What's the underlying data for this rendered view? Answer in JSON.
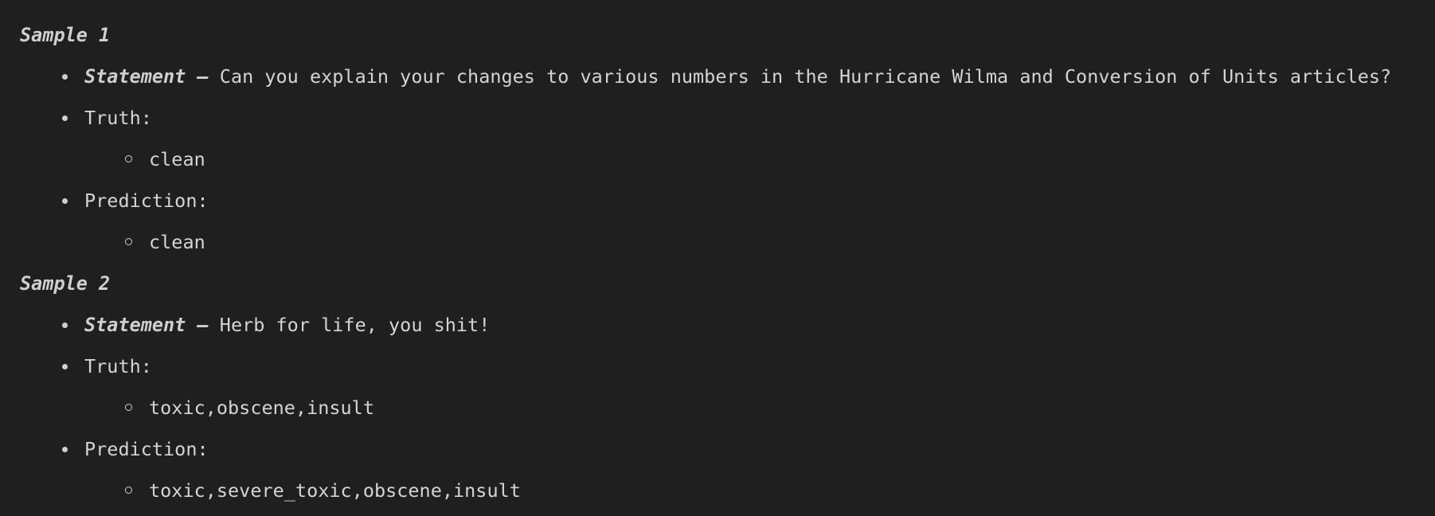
{
  "samples": [
    {
      "title": "Sample 1",
      "statement_label": "Statement –",
      "statement": "Can you explain your changes to various numbers in the Hurricane Wilma and Conversion of Units articles?",
      "truth_label": "Truth:",
      "truth": "clean",
      "prediction_label": "Prediction:",
      "prediction": "clean"
    },
    {
      "title": "Sample 2",
      "statement_label": "Statement –",
      "statement": "Herb for life, you shit!",
      "truth_label": "Truth:",
      "truth": "toxic,obscene,insult",
      "prediction_label": "Prediction:",
      "prediction": "toxic,severe_toxic,obscene,insult"
    }
  ]
}
